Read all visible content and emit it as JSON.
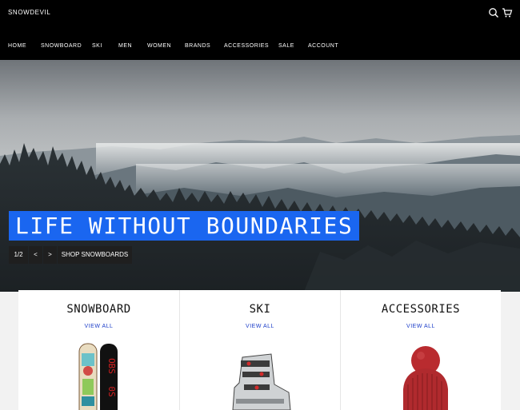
{
  "header": {
    "logo": "SNOWDEVIL",
    "nav": [
      "HOME",
      "SNOWBOARD",
      "SKI",
      "MEN",
      "WOMEN",
      "BRANDS",
      "ACCESSORIES",
      "SALE",
      "ACCOUNT"
    ]
  },
  "hero": {
    "headline": "LIFE WITHOUT BOUNDARIES",
    "slide_counter": "1/2",
    "prev": "<",
    "next": ">",
    "cta": "SHOP SNOWBOARDS"
  },
  "categories": [
    {
      "title": "SNOWBOARD",
      "link": "VIEW ALL"
    },
    {
      "title": "SKI",
      "link": "VIEW ALL"
    },
    {
      "title": "ACCESSORIES",
      "link": "VIEW ALL"
    }
  ],
  "colors": {
    "headline_bg": "#1a66f0",
    "link": "#1a3cc8",
    "header_bg": "#000000"
  },
  "icons": [
    "search-icon",
    "cart-icon"
  ]
}
